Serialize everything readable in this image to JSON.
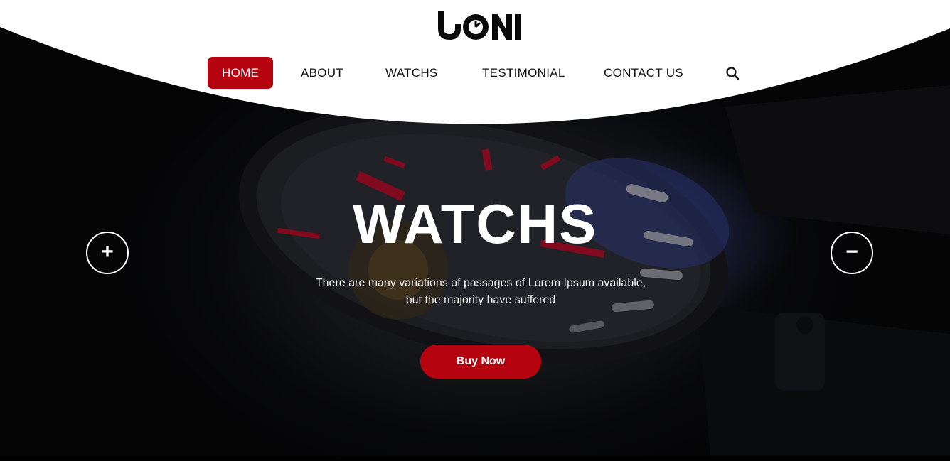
{
  "brand": {
    "logo_text": "UONI",
    "accent_color": "#b5030f"
  },
  "nav": {
    "items": [
      {
        "label": "HOME",
        "active": true
      },
      {
        "label": "ABOUT",
        "active": false
      },
      {
        "label": "WATCHS",
        "active": false
      },
      {
        "label": "TESTIMONIAL",
        "active": false
      },
      {
        "label": "CONTACT US",
        "active": false
      }
    ],
    "search_icon": "search-icon"
  },
  "hero": {
    "title": "WATCHS",
    "subtitle": "There are many variations of passages of Lorem Ipsum available, but the majority have suffered",
    "cta_label": "Buy Now",
    "prev_glyph": "+",
    "next_glyph": "−",
    "background_image": "watch-closeup"
  }
}
